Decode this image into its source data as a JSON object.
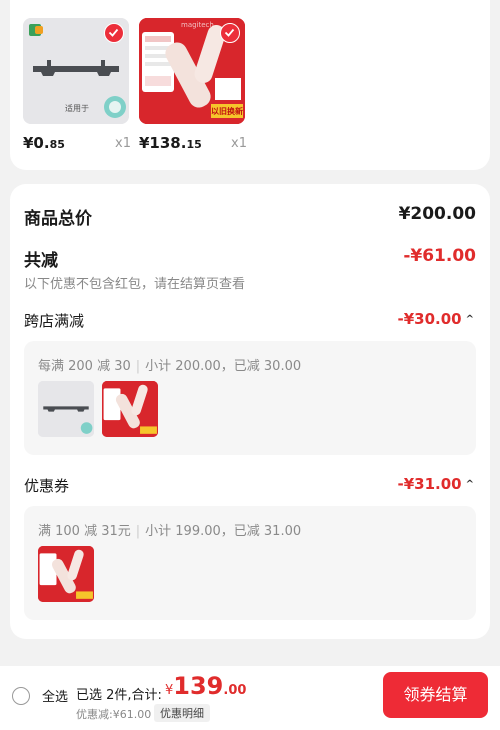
{
  "items": [
    {
      "price_int": "¥0.",
      "price_dec": "85",
      "qty": "x1",
      "usage_label": "适用于",
      "icon": "rail-accessory"
    },
    {
      "price_int": "¥138.",
      "price_dec": "15",
      "qty": "x1",
      "brand": "magitech",
      "badge": "以旧换新",
      "icon": "hair-tool"
    }
  ],
  "summary": {
    "total_label": "商品总价",
    "total_value": "¥200.00",
    "reduce_label": "共减",
    "reduce_value": "-¥61.00",
    "note": "以下优惠不包含红包，请在结算页查看"
  },
  "cross_store": {
    "title": "跨店满减",
    "value": "-¥30.00",
    "rule": "每满 200 减 30",
    "detail": "小计 200.00，已减 30.00"
  },
  "coupon": {
    "title": "优惠券",
    "value": "-¥31.00",
    "rule": "满 100 减 31元",
    "detail": "小计 199.00，已减 31.00"
  },
  "bottom_bar": {
    "select_all": "全选",
    "selected_info": "已选 2件,合计:",
    "currency": "¥",
    "total_int": "139",
    "total_dec": ".00",
    "discount": "优惠减:¥61.00",
    "discount_detail": "优惠明细",
    "checkout": "领券结算"
  },
  "colors": {
    "accent": "#ee2b36",
    "price_red": "#e02c2c",
    "background": "#f2f2f2"
  }
}
